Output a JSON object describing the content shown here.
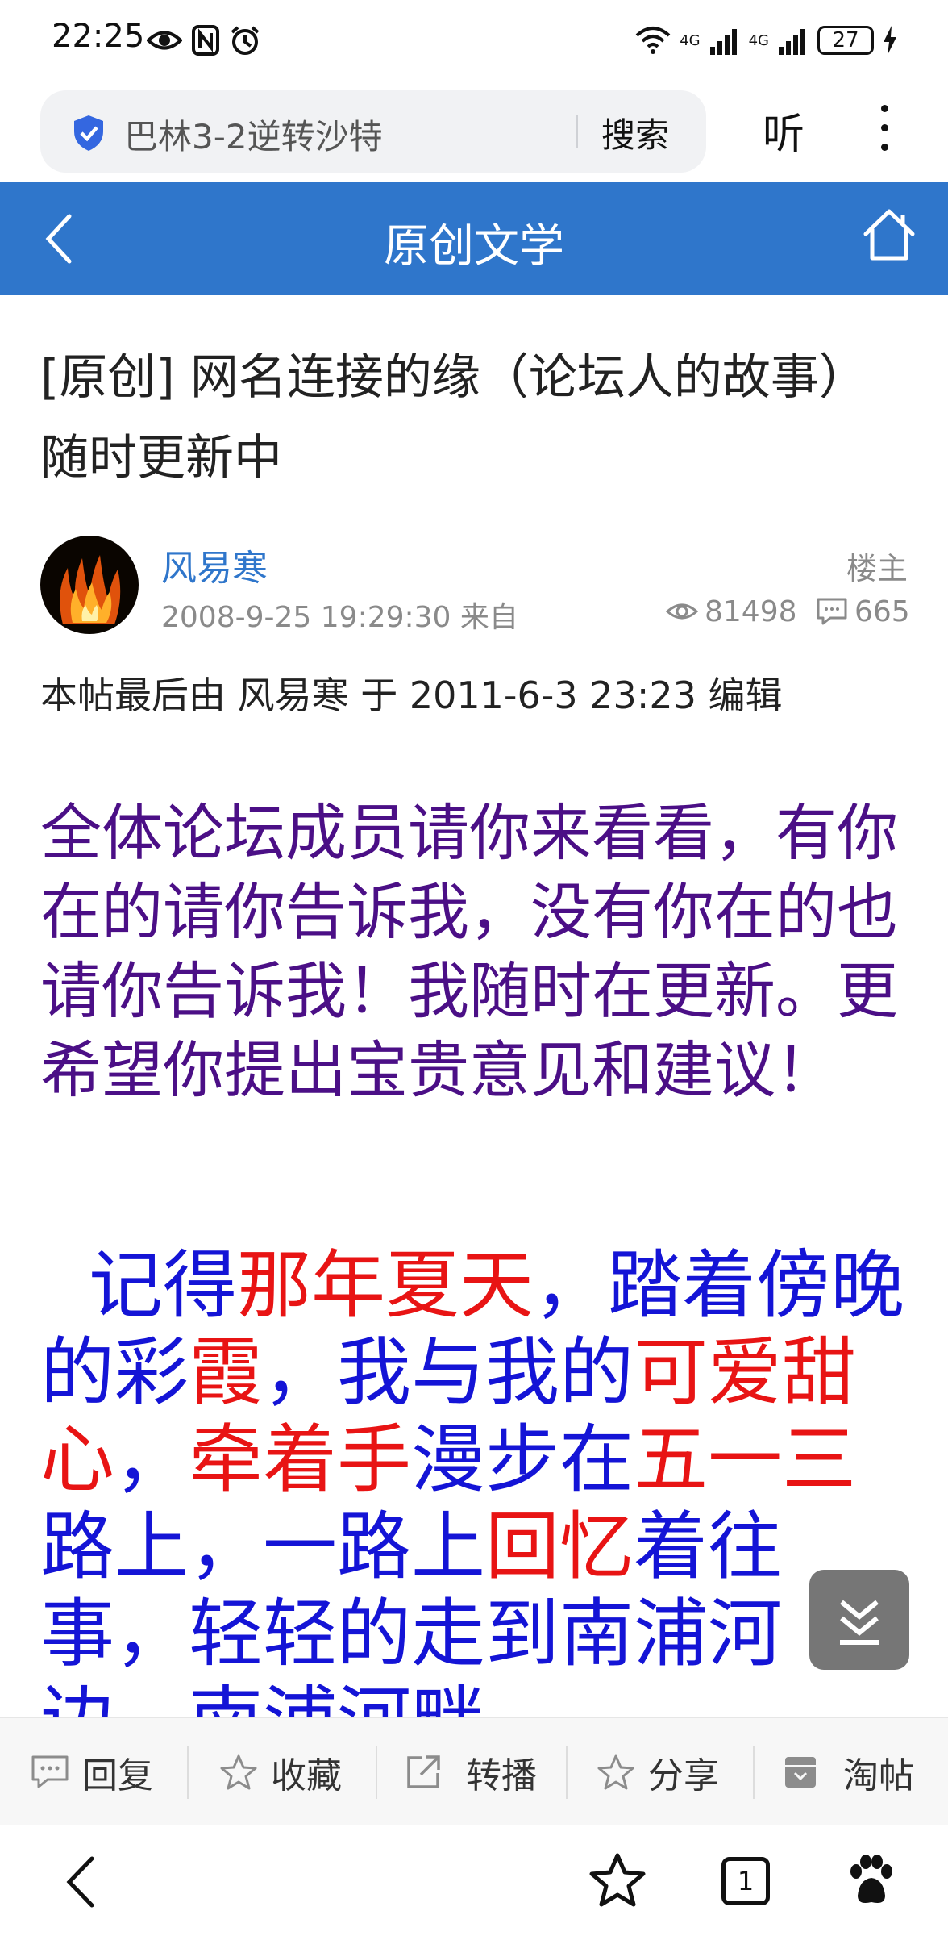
{
  "status_bar": {
    "time": "22:25",
    "battery": "27",
    "network_1": "4G",
    "network_2": "4G",
    "icons": [
      "eye-icon",
      "nfc-icon",
      "alarm-icon",
      "wifi-icon",
      "signal-icon",
      "charging-icon"
    ]
  },
  "browser": {
    "search_query": "巴林3-2逆转沙特",
    "search_button": "搜索",
    "listen_button": "听"
  },
  "header": {
    "title": "原创文学"
  },
  "post": {
    "title": "[原创] 网名连接的缘（论坛人的故事）随时更新中",
    "author": "风易寒",
    "role": "楼主",
    "meta": "2008-9-25 19:29:30 来自",
    "views": "81498",
    "replies": "665",
    "edit_note": "本帖最后由 风易寒 于 2011-6-3 23:23 编辑",
    "intro": "全体论坛成员请你来看看，有你在的请你告诉我，没有你在的也请你告诉我！我随时在更新。更希望你提出宝贵意见和建议！",
    "story_segments": [
      {
        "text": "记得",
        "color": "blue"
      },
      {
        "text": "那年夏天",
        "color": "red"
      },
      {
        "text": "，踏着傍晚的彩",
        "color": "blue"
      },
      {
        "text": "霞",
        "color": "red"
      },
      {
        "text": "，我与我的",
        "color": "blue"
      },
      {
        "text": "可爱甜心",
        "color": "red"
      },
      {
        "text": "，",
        "color": "blue"
      },
      {
        "text": "牵着手",
        "color": "red"
      },
      {
        "text": "漫步在",
        "color": "blue"
      },
      {
        "text": "五一三",
        "color": "red"
      },
      {
        "text": "路上，一路上",
        "color": "blue"
      },
      {
        "text": "回忆",
        "color": "red"
      },
      {
        "text": "着往事，轻轻的走到南浦河边，南浦河畔",
        "color": "blue"
      }
    ]
  },
  "actions": [
    {
      "label": "回复",
      "icon": "comment-icon"
    },
    {
      "label": "收藏",
      "icon": "star-icon"
    },
    {
      "label": "转播",
      "icon": "share-out-icon"
    },
    {
      "label": "分享",
      "icon": "star-icon"
    },
    {
      "label": "淘帖",
      "icon": "archive-icon"
    }
  ],
  "bottom_nav": {
    "tab_count": "1"
  },
  "colors": {
    "header_blue": "#2f76cb",
    "intro_purple": "#4b0f86",
    "story_blue": "#1414d6",
    "story_red": "#e81414"
  }
}
